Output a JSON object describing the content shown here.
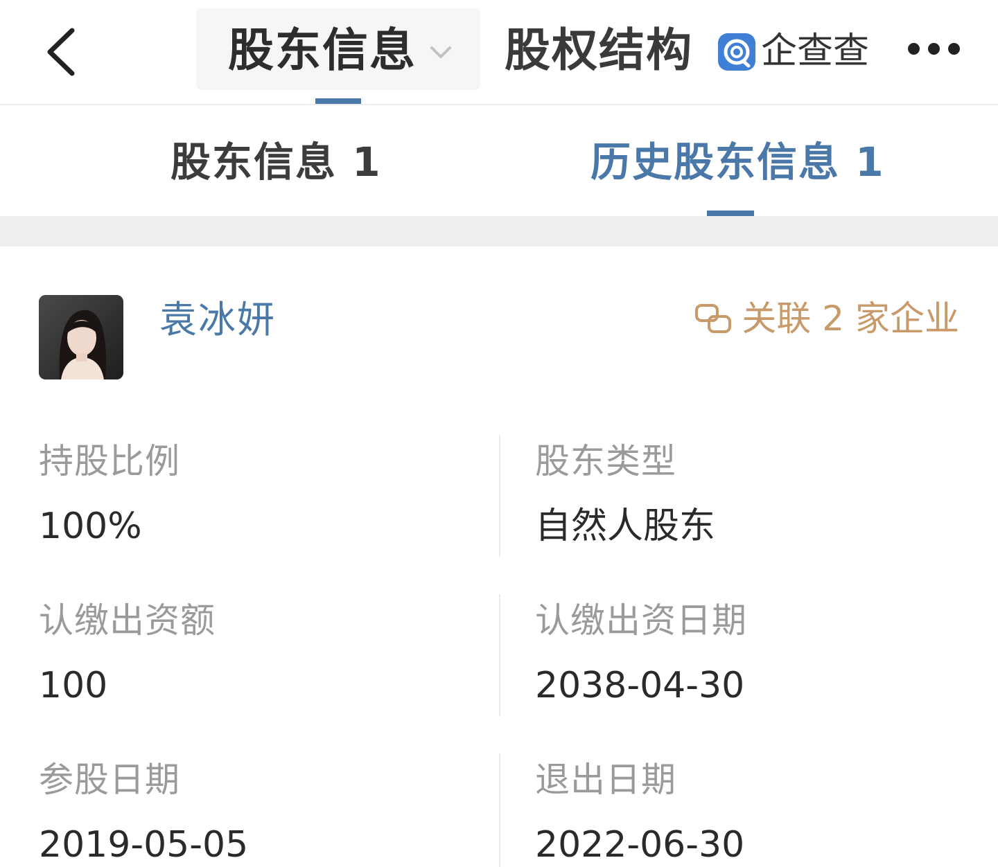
{
  "nav": {
    "active_tab": "股东信息",
    "second_tab": "股权结构",
    "brand": "企查查"
  },
  "subtabs": [
    {
      "label": "股东信息 1",
      "active": false
    },
    {
      "label": "历史股东信息 1",
      "active": true
    }
  ],
  "shareholder": {
    "name": "袁冰妍",
    "related_text": "关联 2 家企业"
  },
  "fields": {
    "share_ratio": {
      "label": "持股比例",
      "value": "100%"
    },
    "holder_type": {
      "label": "股东类型",
      "value": "自然人股东"
    },
    "subscribed_amount": {
      "label": "认缴出资额",
      "value": "100"
    },
    "subscribed_date": {
      "label": "认缴出资日期",
      "value": "2038-04-30"
    },
    "join_date": {
      "label": "参股日期",
      "value": "2019-05-05"
    },
    "exit_date": {
      "label": "退出日期",
      "value": "2022-06-30"
    }
  },
  "icons": [
    "back-icon",
    "chevron-down-icon",
    "brand-logo-icon",
    "more-icon",
    "link-icon"
  ],
  "colors": {
    "accent": "#4a78a8",
    "related": "#c89a6a",
    "label": "#9a9a9a",
    "brand": "#3f7fd6"
  }
}
